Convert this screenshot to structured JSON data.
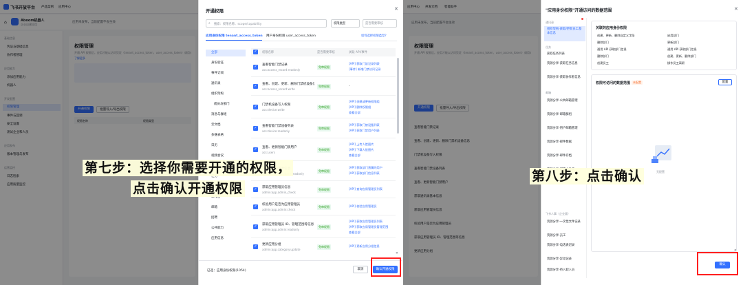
{
  "left_app": {
    "brand": "飞书开放平台",
    "nav": [
      "产品案例",
      "应用中心",
      "开发文档",
      "智能助手"
    ],
    "nav_badge": "2024更新",
    "app_name": "Aboom机器人",
    "app_sub": "企业自建应用",
    "banner": "应用未发布，当前配置不会生效",
    "banner_link": "创建版本",
    "sidebar_groups": [
      {
        "title": "基础信息",
        "items": [
          "凭证与基础信息",
          "协作者管理"
        ]
      },
      {
        "title": "应用能力",
        "items": [
          "添加应用能力",
          "机器人"
        ]
      },
      {
        "title": "开发配置",
        "items": [
          "权限管理",
          "事件与回调",
          "安全设置",
          "测试企业和人员"
        ]
      },
      {
        "title": "应用发布",
        "items": [
          "版本管理与发布"
        ]
      },
      {
        "title": "运营监控",
        "items": [
          "日志检索",
          "应用质量监控"
        ]
      }
    ],
    "page_title": "权限管理",
    "page_desc": "开通 API 权限后，应用才能以访问凭证（tenant_access_token、user_access_token）调用对应 API。",
    "page_link": "了解更多",
    "buttons": [
      "开通权限",
      "批量导入/导出权限"
    ],
    "table_headers": [
      "权限名称",
      "权限类型",
      "应用身份权限",
      "操作"
    ]
  },
  "dialog1": {
    "title": "开通权限",
    "search_placeholder": "搜索：权限名称、scope/capability",
    "filter1": "权限类型",
    "filter2": "是否需要审核",
    "tabs": [
      "应用身份权限 tenant_access_token",
      "用户身份权限 user_access_token"
    ],
    "tab_link": "如何选择权限类型?",
    "categories": [
      "全部",
      "身份验证",
      "事件订阅",
      "通讯录",
      "组织架构",
      "成员与部门",
      "消息与群组",
      "云文档",
      "多维表格",
      "日历",
      "视频会议",
      "会议室",
      "任务",
      "审批",
      "工作台",
      "邮箱",
      "招聘",
      "公共能力",
      "应用信息"
    ],
    "col_headers": [
      "权限名称",
      "是否需要审核",
      "关联 API/事件"
    ],
    "rows": [
      {
        "name": "查看智能门禁记录",
        "scope": "acs:access_record:readonly",
        "tag": "免审权限",
        "apis": [
          "[API] 获取门禁记录列表",
          "[事件] 新增门禁访问记录"
        ]
      },
      {
        "name": "查看、创建、更新、删除门禁机设备信息",
        "scope": "acs:access_record:write",
        "tag": "免审权限",
        "apis": [
          "-"
        ]
      },
      {
        "name": "门禁机设备写入权限",
        "scope": "acs:device:write",
        "tag": "免审权限",
        "apis": [
          "[API] 创建或更新权限组",
          "[API] 删除权限组",
          "查看全部"
        ]
      },
      {
        "name": "查看智能门禁设备列表",
        "scope": "acs:device:readonly",
        "tag": "免审权限",
        "apis": [
          "[API] 获取门禁设备列表",
          "[API] 获取门禁用户列表"
        ]
      },
      {
        "name": "查看、更新智能门禁用户",
        "scope": "acs:users",
        "tag": "免审权限",
        "apis": [
          "[API] 上传人脸图片",
          "[API] 下载人脸图片",
          "查看全部"
        ]
      },
      {
        "name": "获取通讯录基本信息",
        "scope": "contact:contact.base:readonly",
        "tag": "免审权限",
        "apis": [
          "[API] 获取部门直属的用户",
          "[API] 获取部门信息列表"
        ]
      },
      {
        "name": "获取应用管理员信息",
        "scope": "admin:app.admin_check",
        "tag": "免审权限",
        "apis": [
          "[API] 查询应用管理员列表"
        ]
      },
      {
        "name": "校验用户是否为应用管理员",
        "scope": "admin:app.admin:check",
        "tag": "免审权限",
        "apis": [
          "[API] 校验应用管理员"
        ]
      },
      {
        "name": "获取应用管理员 ID、管理范围等信息",
        "scope": "admin:app.admin:readonly",
        "tag": "免审权限",
        "apis": [
          "[API] 获取应用管理员列表",
          "[API] 获取应用管理员管理范围",
          "查看全部"
        ]
      },
      {
        "name": "更新应用分组",
        "scope": "admin:app.category:update",
        "tag": "免审权限",
        "apis": [
          "[API] 更新应用分组信息"
        ]
      }
    ],
    "footer_selected": "已选：应用身份权限(1054)",
    "cancel": "取消",
    "confirm": "确认开通权限"
  },
  "dialog2": {
    "title": "\"应用身份权限\"开通访问的数据范围",
    "sidebar_header": "通讯录",
    "sidebar_items": [
      "组织架构-获取/更新员工基本信息",
      "任务",
      "获取任务列表",
      "资源分享-获取任务信息",
      "资源分享-获取协作者信息",
      "邮箱",
      "资源分享-公共邮箱管理",
      "资源分享-邮箱群组",
      "资源分享-用户邮箱管理",
      "资源分享-邮件数据",
      "资源分享-邮件存档",
      "资源分享-邮箱文件夹",
      "飞书人事（企业版）",
      "资源分享-一次性文件记录",
      "资源分享-员工",
      "资源分享-电话表记录",
      "资源分享-异动记录",
      "资源分享-待入职人员"
    ],
    "section1": "关联的应用身份权限",
    "perm_pairs": [
      [
        "创建、更新、删除自定义字段",
        "启用部门"
      ],
      [
        "删除部门",
        "更新部门"
      ],
      [
        "通用 API 获取部门信息",
        "通用 API 获取部门信息"
      ],
      [
        "删除部门",
        "创建、更新、删除部门"
      ],
      [
        "创建员工",
        "操作员工离职"
      ]
    ],
    "section2": "权限可访问的数据范围",
    "section2_tag": "未配置",
    "section2_btn": "配置",
    "empty": "无配置",
    "confirm": "确认"
  },
  "captions": {
    "step7_line1": "第七步：选择你需要开通的权限，",
    "step7_line2": "点击确认开通权限",
    "step8": "第八步：点击确认"
  }
}
